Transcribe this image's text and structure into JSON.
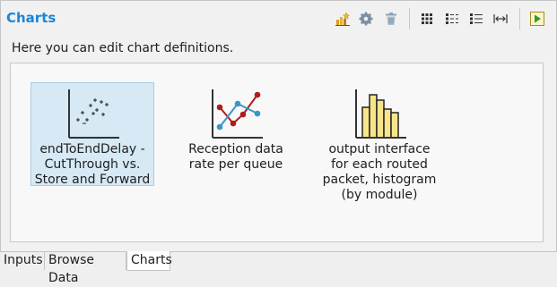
{
  "panel": {
    "title": "Charts",
    "description": "Here you can edit chart definitions."
  },
  "toolbar": [
    {
      "name": "new-chart-icon",
      "color": "#d99a1a"
    },
    {
      "name": "gear-icon",
      "color": "#7c8fa3"
    },
    {
      "name": "trash-icon",
      "color": "#8aa3b8"
    },
    {
      "name": "grid-view-icon"
    },
    {
      "name": "list-view-icon"
    },
    {
      "name": "details-view-icon"
    },
    {
      "name": "fit-width-icon"
    },
    {
      "name": "run-icon",
      "color": "#2e9a2e"
    }
  ],
  "charts": [
    {
      "label": "endToEndDelay - CutThrough vs. Store and Forward",
      "type": "scatter",
      "selected": true
    },
    {
      "label": "Reception data rate per queue",
      "type": "line",
      "selected": false
    },
    {
      "label": "output interface for each routed packet, histogram (by module)",
      "type": "histogram",
      "selected": false
    }
  ],
  "tabs": [
    {
      "label": "Inputs",
      "active": false
    },
    {
      "label": "Browse Data",
      "active": false
    },
    {
      "label": "Charts",
      "active": true
    }
  ],
  "colors": {
    "title": "#1a86d8",
    "selection": "#d6e9f5",
    "line_series_a": "#b01c1c",
    "line_series_b": "#3a95c9",
    "histogram_fill": "#f7e58a"
  }
}
